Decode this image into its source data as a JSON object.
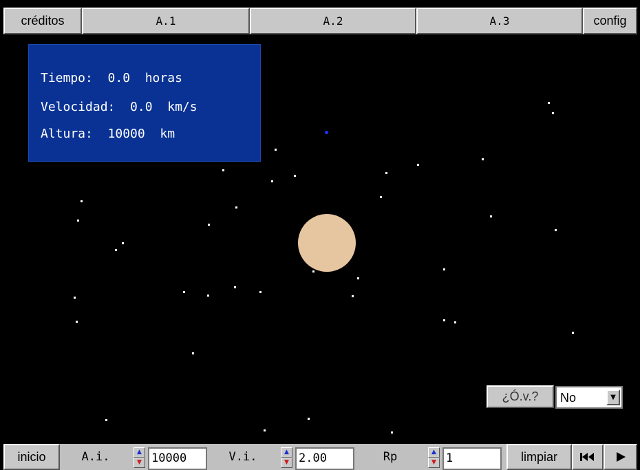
{
  "top_menu": {
    "credits_label": "créditos",
    "tab1_label": "A.1",
    "tab2_label": "A.2",
    "tab3_label": "A.3",
    "config_label": "config"
  },
  "info": {
    "time_text": "Tiempo:  0.0  horas",
    "velocity_text": "Velocidad:  0.0  km/s",
    "altitude_text": "Altura:  10000  km"
  },
  "overlay": {
    "label": "¿Ó.v.?",
    "selected": "No"
  },
  "bottom_bar": {
    "start_label": "inicio",
    "ai_label": "A.i.",
    "ai_value": "10000",
    "vi_label": "V.i.",
    "vi_value": "2.00",
    "rp_label": "Rp",
    "rp_value": "1",
    "clear_label": "limpiar"
  },
  "colors": {
    "info_panel": "#0a3294",
    "planet": "#e6c6a0",
    "satellite": "#2030ff",
    "background": "#000000"
  },
  "icons": {
    "rewind": "rewind-icon",
    "play": "play-icon",
    "spin_up": "triangle-up-icon",
    "spin_down": "triangle-down-icon",
    "dropdown": "chevron-down-icon"
  }
}
